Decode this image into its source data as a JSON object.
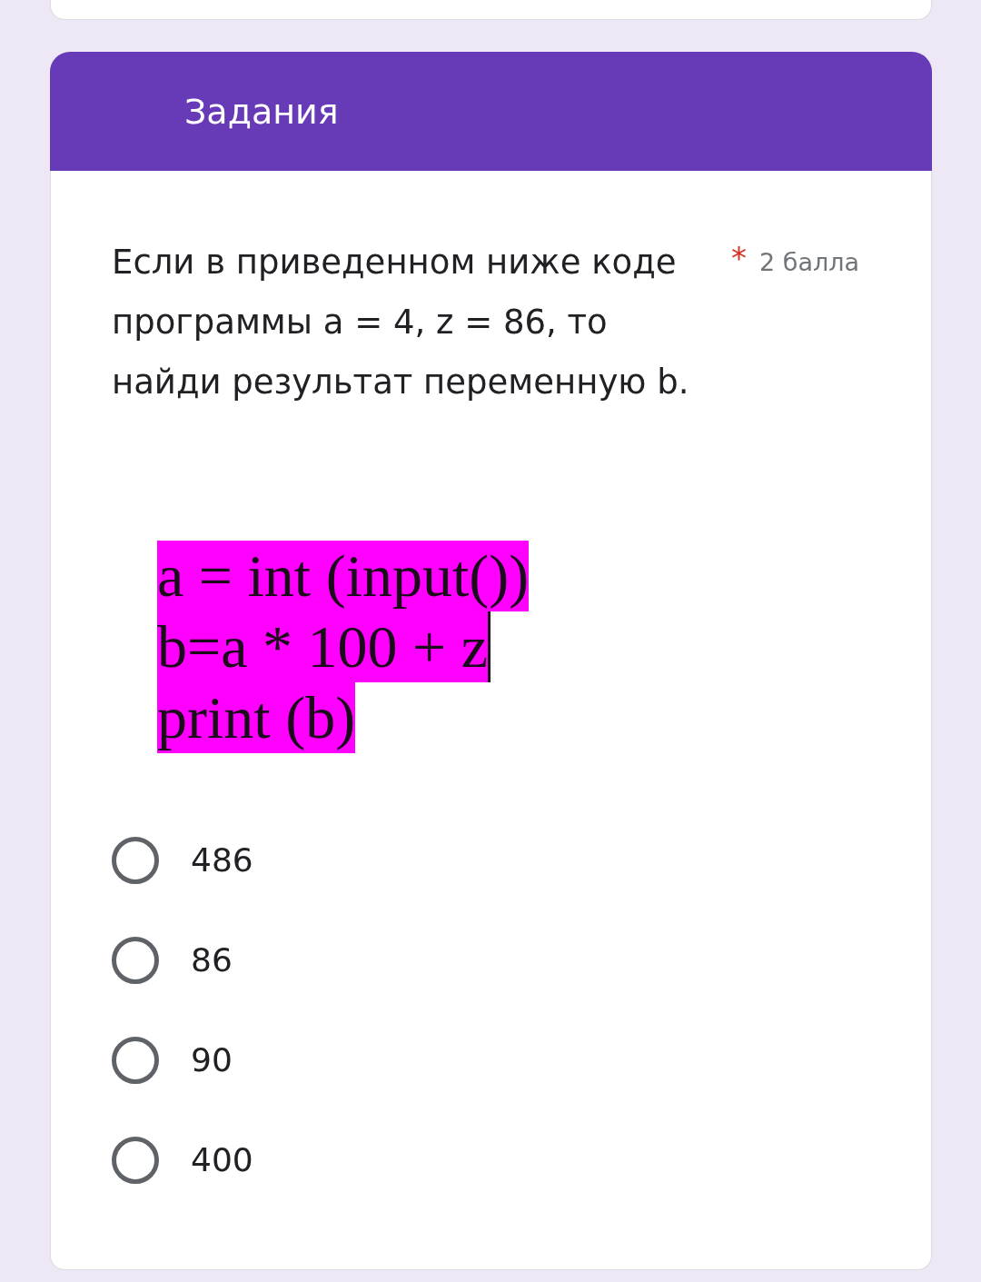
{
  "section": {
    "title": "Задания"
  },
  "question": {
    "text": "Если в приведенном ниже коде программы a = 4, z = 86, то найди результат переменную b.",
    "required_mark": "*",
    "points": "2 балла",
    "code_image": {
      "lines": [
        {
          "text": "a = int (input())",
          "cursor": false
        },
        {
          "text": "b=a * 100 + z",
          "cursor": true
        },
        {
          "text": "print (b)",
          "cursor": false
        }
      ]
    },
    "options": [
      {
        "label": "486",
        "selected": false
      },
      {
        "label": "86",
        "selected": false
      },
      {
        "label": "90",
        "selected": false
      },
      {
        "label": "400",
        "selected": false
      }
    ]
  }
}
